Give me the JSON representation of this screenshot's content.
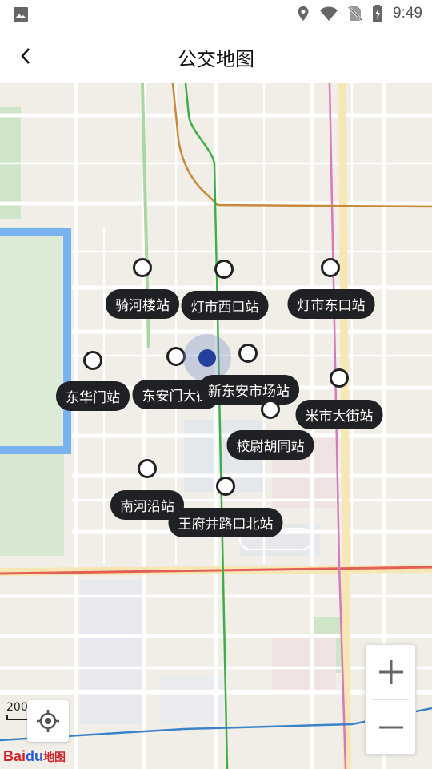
{
  "status_bar": {
    "time": "9:49"
  },
  "app_bar": {
    "title": "公交地图"
  },
  "stops": [
    {
      "id": "qiheloujie",
      "label": "骑河楼站"
    },
    {
      "id": "dengshixikou",
      "label": "灯市西口站"
    },
    {
      "id": "dengshidongkou",
      "label": "灯市东口站"
    },
    {
      "id": "donghuamen",
      "label": "东华门站"
    },
    {
      "id": "donganmendajie",
      "label": "东安门大街"
    },
    {
      "id": "xindongan",
      "label": "新东安市场站"
    },
    {
      "id": "mishidajie",
      "label": "米市大街站"
    },
    {
      "id": "xiaoweihutong",
      "label": "校尉胡同站"
    },
    {
      "id": "nanheyan",
      "label": "南河沿站"
    },
    {
      "id": "wangfujing",
      "label": "王府井路口北站"
    }
  ],
  "map": {
    "scale_label": "200米",
    "logo_text": "Bai",
    "logo_paw": "du",
    "logo_suffix": "地图",
    "zoom_in_label": "+",
    "zoom_out_label": "−"
  },
  "colors": {
    "route_green": "#3fae49",
    "route_pink": "#d77ab9",
    "route_brown": "#c8893a",
    "route_red": "#e46055",
    "moat_blue": "#6aa8ea"
  }
}
